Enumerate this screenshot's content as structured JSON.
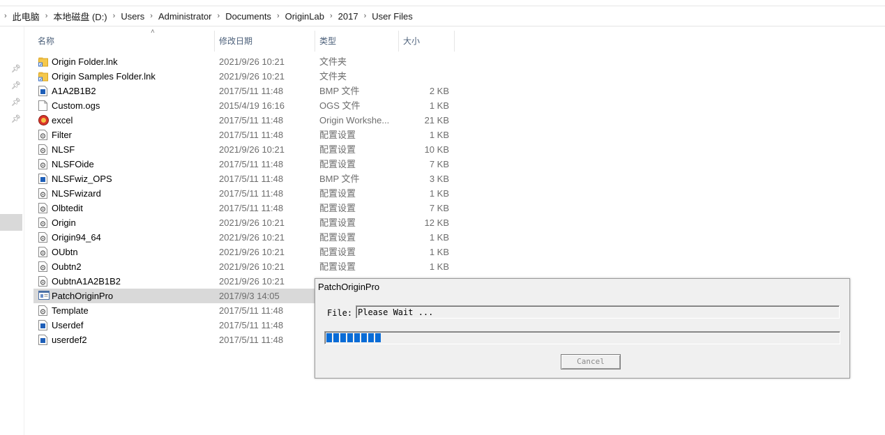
{
  "breadcrumb": [
    "此电脑",
    "本地磁盘 (D:)",
    "Users",
    "Administrator",
    "Documents",
    "OriginLab",
    "2017",
    "User Files"
  ],
  "columns": {
    "name": "名称",
    "date": "修改日期",
    "type": "类型",
    "size": "大小"
  },
  "files": [
    {
      "name": "Origin Folder.lnk",
      "date": "2021/9/26 10:21",
      "type": "文件夹",
      "size": "",
      "icon": "folder-shortcut-icon"
    },
    {
      "name": "Origin Samples Folder.lnk",
      "date": "2021/9/26 10:21",
      "type": "文件夹",
      "size": "",
      "icon": "folder-shortcut-icon"
    },
    {
      "name": "A1A2B1B2",
      "date": "2017/5/11 11:48",
      "type": "BMP 文件",
      "size": "2 KB",
      "icon": "bmp-file-icon"
    },
    {
      "name": "Custom.ogs",
      "date": "2015/4/19 16:16",
      "type": "OGS 文件",
      "size": "1 KB",
      "icon": "blank-file-icon"
    },
    {
      "name": "excel",
      "date": "2017/5/11 11:48",
      "type": "Origin Workshe...",
      "size": "21 KB",
      "icon": "origin-worksheet-icon"
    },
    {
      "name": "Filter",
      "date": "2017/5/11 11:48",
      "type": "配置设置",
      "size": "1 KB",
      "icon": "config-file-icon"
    },
    {
      "name": "NLSF",
      "date": "2021/9/26 10:21",
      "type": "配置设置",
      "size": "10 KB",
      "icon": "config-file-icon"
    },
    {
      "name": "NLSFOide",
      "date": "2017/5/11 11:48",
      "type": "配置设置",
      "size": "7 KB",
      "icon": "config-file-icon"
    },
    {
      "name": "NLSFwiz_OPS",
      "date": "2017/5/11 11:48",
      "type": "BMP 文件",
      "size": "3 KB",
      "icon": "bmp-file-icon"
    },
    {
      "name": "NLSFwizard",
      "date": "2017/5/11 11:48",
      "type": "配置设置",
      "size": "1 KB",
      "icon": "config-file-icon"
    },
    {
      "name": "Olbtedit",
      "date": "2017/5/11 11:48",
      "type": "配置设置",
      "size": "7 KB",
      "icon": "config-file-icon"
    },
    {
      "name": "Origin",
      "date": "2021/9/26 10:21",
      "type": "配置设置",
      "size": "12 KB",
      "icon": "config-file-icon"
    },
    {
      "name": "Origin94_64",
      "date": "2021/9/26 10:21",
      "type": "配置设置",
      "size": "1 KB",
      "icon": "config-file-icon"
    },
    {
      "name": "OUbtn",
      "date": "2021/9/26 10:21",
      "type": "配置设置",
      "size": "1 KB",
      "icon": "config-file-icon"
    },
    {
      "name": "Oubtn2",
      "date": "2021/9/26 10:21",
      "type": "配置设置",
      "size": "1 KB",
      "icon": "config-file-icon"
    },
    {
      "name": "OubtnA1A2B1B2",
      "date": "2021/9/26 10:21",
      "type": "",
      "size": "",
      "icon": "config-file-icon"
    },
    {
      "name": "PatchOriginPro",
      "date": "2017/9/3 14:05",
      "type": "",
      "size": "",
      "icon": "application-icon",
      "selected": true
    },
    {
      "name": "Template",
      "date": "2017/5/11 11:48",
      "type": "",
      "size": "",
      "icon": "config-file-icon"
    },
    {
      "name": "Userdef",
      "date": "2017/5/11 11:48",
      "type": "",
      "size": "",
      "icon": "bmp-file-icon"
    },
    {
      "name": "userdef2",
      "date": "2017/5/11 11:48",
      "type": "",
      "size": "",
      "icon": "bmp-file-icon"
    }
  ],
  "dialog": {
    "title": "PatchOriginPro",
    "file_label": "File:",
    "file_value": "Please Wait ...",
    "progress_blocks": 8,
    "cancel_label": "Cancel"
  },
  "colors": {
    "progress": "#0a6cd6",
    "selection": "#d9d9d9",
    "header_text": "#4c607a"
  }
}
